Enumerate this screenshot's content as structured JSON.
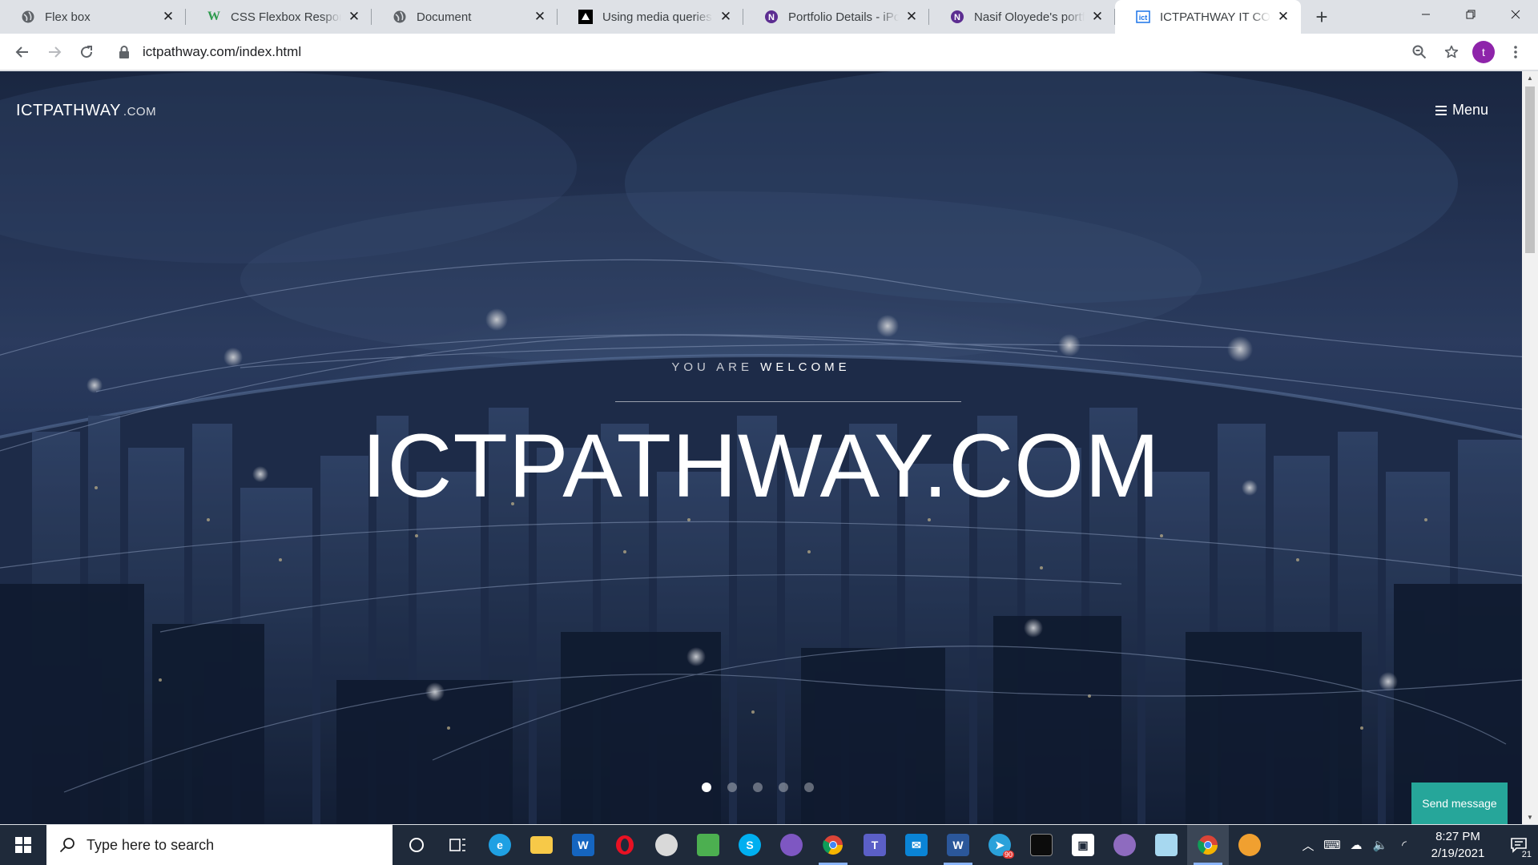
{
  "browser": {
    "tabs": [
      {
        "title": "Flex box",
        "favicon": "globe-icon",
        "active": false
      },
      {
        "title": "CSS Flexbox Responsive",
        "favicon": "w3schools-icon",
        "active": false
      },
      {
        "title": "Document",
        "favicon": "globe-icon",
        "active": false
      },
      {
        "title": "Using media queries -",
        "favicon": "mdn-icon",
        "active": false
      },
      {
        "title": "Portfolio Details - iPortfolio",
        "favicon": "portfolio-icon",
        "active": false
      },
      {
        "title": "Nasif Oloyede's portfolio",
        "favicon": "portfolio-icon",
        "active": false
      },
      {
        "title": "ICTPATHWAY IT CONSULT",
        "favicon": "ictpathway-icon",
        "active": true
      }
    ],
    "new_tab_label": "+",
    "address": "ictpathway.com/index.html",
    "profile_initial": "t",
    "colors": {
      "profile": "#8e24aa",
      "tab_strip": "#dee1e6"
    }
  },
  "page": {
    "brand": {
      "name": "ICTPATHWAY",
      "suffix": ".COM"
    },
    "menu_label": "Menu",
    "welcome_prefix": "YOU ARE",
    "welcome_highlight": "WELCOME",
    "headline": "ICTPATHWAY.COM",
    "slider": {
      "count": 5,
      "active_index": 0
    },
    "send_message": "Send message",
    "colors": {
      "send_message": "#26a69a",
      "hero_overlay": "#1d2a45"
    }
  },
  "taskbar": {
    "search_placeholder": "Type here to search",
    "apps": [
      {
        "name": "cortana-icon",
        "color": ""
      },
      {
        "name": "task-view-icon",
        "color": ""
      },
      {
        "name": "edge-icon",
        "color": "#1fa0e3"
      },
      {
        "name": "file-explorer-icon",
        "color": "#f7c948"
      },
      {
        "name": "wave-editor-icon",
        "color": "#1565c0"
      },
      {
        "name": "opera-icon",
        "color": "#e81123"
      },
      {
        "name": "paint-app-icon",
        "color": "#d9d9d9"
      },
      {
        "name": "network-app-icon",
        "color": "#4caf50"
      },
      {
        "name": "skype-icon",
        "color": "#00aff0"
      },
      {
        "name": "tor-browser-icon",
        "color": "#7e57c2"
      },
      {
        "name": "chrome-icon",
        "color": "#34a853"
      },
      {
        "name": "teams-icon",
        "color": "#5b5fc7"
      },
      {
        "name": "mail-icon",
        "color": "#0a84d6"
      },
      {
        "name": "word-icon",
        "color": "#2b579a"
      },
      {
        "name": "telegram-icon",
        "color": "#2aa1da"
      },
      {
        "name": "terminal-icon",
        "color": "#0c0c0c"
      },
      {
        "name": "sourcetree-icon",
        "color": "#ffffff"
      },
      {
        "name": "github-desktop-icon",
        "color": "#8e6bbf"
      },
      {
        "name": "notepad-icon",
        "color": "#a7d8f0"
      },
      {
        "name": "chrome-icon-active",
        "color": "#34a853"
      },
      {
        "name": "paint-3d-icon",
        "color": "#f0a030"
      }
    ],
    "telegram_badge": "90",
    "time": "8:27 PM",
    "date": "2/19/2021",
    "notification_count": "21"
  }
}
